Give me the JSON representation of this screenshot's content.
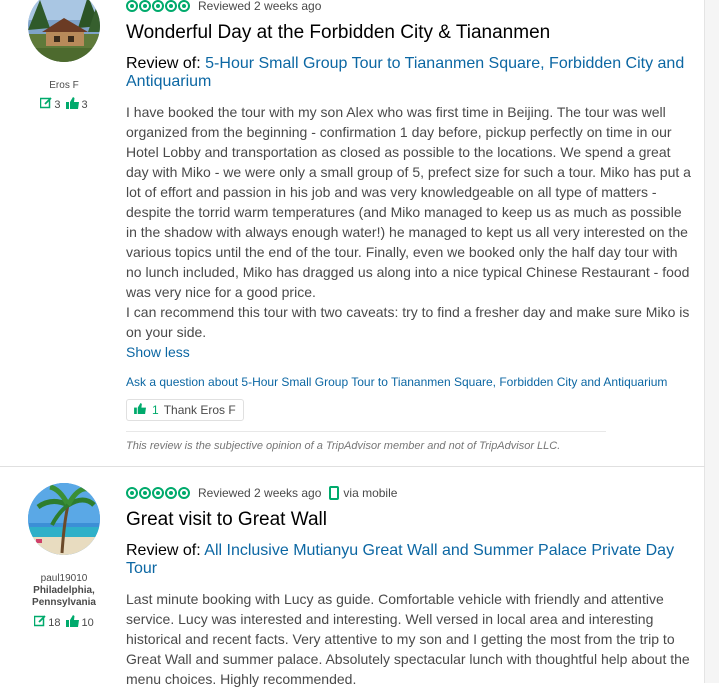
{
  "colors": {
    "accent": "#00aa6c",
    "link": "#0c67a3",
    "text": "#4a4a4a"
  },
  "reviews": [
    {
      "member": {
        "username": "Eros F",
        "location": "",
        "contributions": "3",
        "helpful_votes": "3"
      },
      "rating_bubbles": 5,
      "date_text": "Reviewed 2 weeks ago",
      "mobile_text": "",
      "title": "Wonderful Day at the Forbidden City & Tiananmen",
      "review_of_label": "Review of:",
      "review_of_link": "5-Hour Small Group Tour to Tiananmen Square, Forbidden City and Antiquarium",
      "paragraphs": [
        "I have booked the tour with my son Alex who was first time in Beijing. The tour was well organized from the beginning - confirmation 1 day before, pickup perfectly on time in our Hotel Lobby and transportation as closed as possible to the locations. We spend a great day with Miko - we were only a small group of 5, prefect size for such a tour. Miko has put a lot of effort and passion in his job and was very knowledgeable on all type of matters - despite the torrid warm temperatures (and Miko managed to keep us as much as possible in the shadow with always enough water!) he managed to kept us all very interested on the various topics until the end of the tour. Finally, even we booked only the half day tour with no lunch included, Miko has dragged us along into a nice typical Chinese Restaurant - food was very nice for a good price.",
        "I can recommend this tour with two caveats: try to find a fresher day and make sure Miko is on your side."
      ],
      "show_less": "Show less",
      "ask_question": "Ask a question about 5-Hour Small Group Tour to Tiananmen Square, Forbidden City and Antiquarium",
      "thank_count": "1",
      "thank_label": "Thank Eros F",
      "disclaimer": "This review is the subjective opinion of a TripAdvisor member and not of TripAdvisor LLC."
    },
    {
      "member": {
        "username": "paul19010",
        "location": "Philadelphia, Pennsylvania",
        "contributions": "18",
        "helpful_votes": "10"
      },
      "rating_bubbles": 5,
      "date_text": "Reviewed 2 weeks ago",
      "mobile_text": "via mobile",
      "title": "Great visit to Great Wall",
      "review_of_label": "Review of:",
      "review_of_link": "All Inclusive Mutianyu Great Wall and Summer Palace Private Day Tour",
      "paragraphs": [
        "Last minute booking with Lucy as guide. Comfortable vehicle with friendly and attentive service. Lucy was interested and interesting. Well versed in local area and interesting historical and recent facts. Very attentive to my son and I getting the most from the trip to Great Wall and summer palace. Absolutely spectacular lunch with thoughtful help about the menu choices. Highly recommended."
      ]
    }
  ]
}
